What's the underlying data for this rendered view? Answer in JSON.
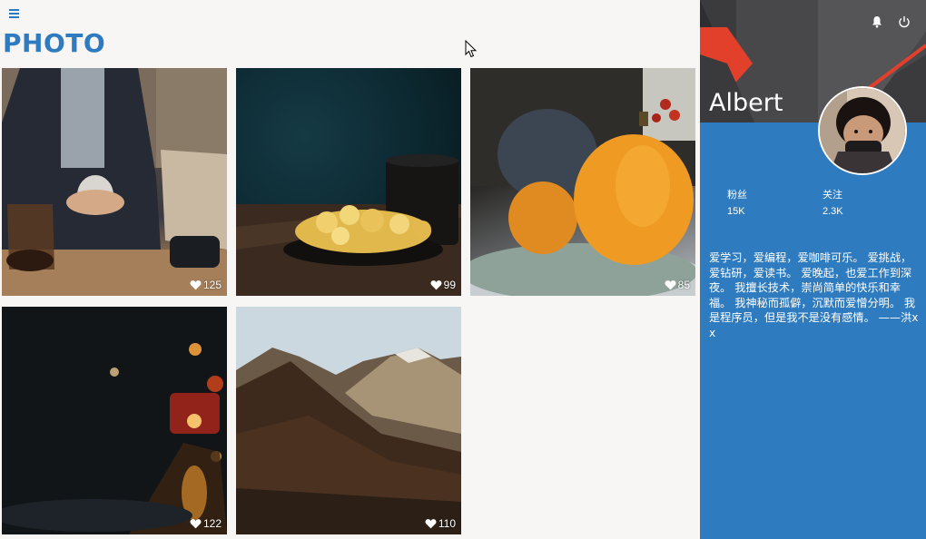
{
  "header": {
    "menu_icon": "hamburger-icon",
    "title": "PHOTO"
  },
  "photos": [
    {
      "subject": "man holding coffee cup",
      "likes": "125"
    },
    {
      "subject": "popcorn and coffee mug",
      "likes": "99"
    },
    {
      "subject": "pumpkins on plate",
      "likes": "85"
    },
    {
      "subject": "rainy street at night",
      "likes": "122"
    },
    {
      "subject": "forested mountains",
      "likes": "110"
    }
  ],
  "profile": {
    "name": "Albert",
    "notifications_icon": "bell-icon",
    "power_icon": "power-icon",
    "stats": [
      {
        "label": "粉丝",
        "value": "15K"
      },
      {
        "label": "关注",
        "value": "2.3K"
      }
    ],
    "bio": "爱学习，爱编程，爱咖啡可乐。 爱挑战，爱钻研，爱读书。 爱晚起，也爱工作到深夜。 我擅长技术，崇尚简单的快乐和幸福。 我神秘而孤僻，沉默而爱憎分明。 我是程序员，但是我不是没有感情。 ——洪xx"
  },
  "colors": {
    "accent": "#2f7bbf",
    "panel_dark": "#3b3b3d",
    "panel_red": "#e2402b",
    "page_bg": "#f7f6f5"
  }
}
